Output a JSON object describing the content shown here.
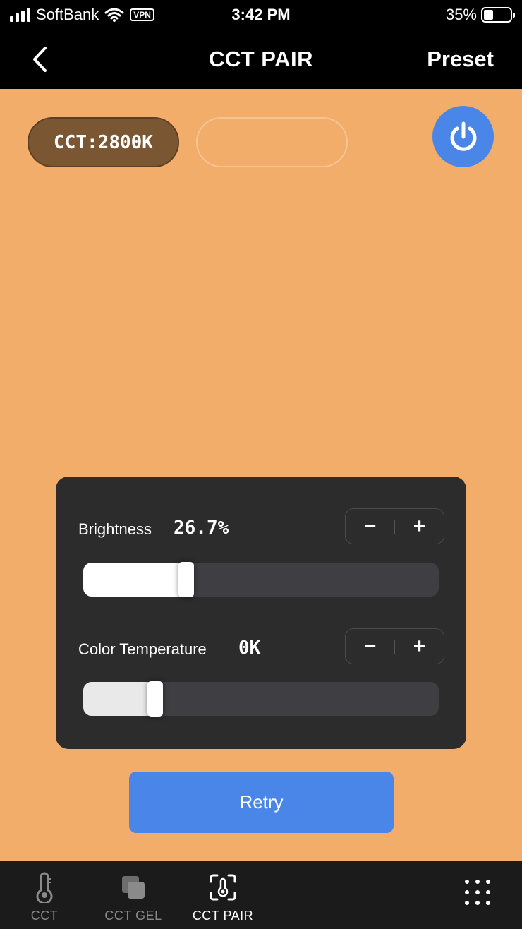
{
  "status_bar": {
    "carrier": "SoftBank",
    "vpn": "VPN",
    "time": "3:42 PM",
    "battery": "35%",
    "battery_level": 0.35
  },
  "nav": {
    "back_icon": "chevron-left-icon",
    "title": "CCT PAIR",
    "preset": "Preset"
  },
  "main": {
    "background": "#f2ad6b",
    "cct_pill": "CCT:2800K",
    "power_icon": "power-icon"
  },
  "controls": {
    "brightness": {
      "label": "Brightness",
      "value": "26.7%",
      "level": 0.267,
      "minus": "−",
      "plus": "+"
    },
    "color_temperature": {
      "label": "Color Temperature",
      "value": "0K",
      "level": 0.18,
      "minus": "−",
      "plus": "+"
    }
  },
  "retry": "Retry",
  "tabs": [
    {
      "label": "CCT",
      "icon": "thermometer-icon",
      "active": false
    },
    {
      "label": "CCT GEL",
      "icon": "gel-layers-icon",
      "active": false
    },
    {
      "label": "CCT PAIR",
      "icon": "pair-scan-icon",
      "active": true
    }
  ],
  "more_icon": "more-grid-icon",
  "colors": {
    "accent": "#4a86e8",
    "panel": "#2c2c2d",
    "pill": "#7a5633"
  }
}
